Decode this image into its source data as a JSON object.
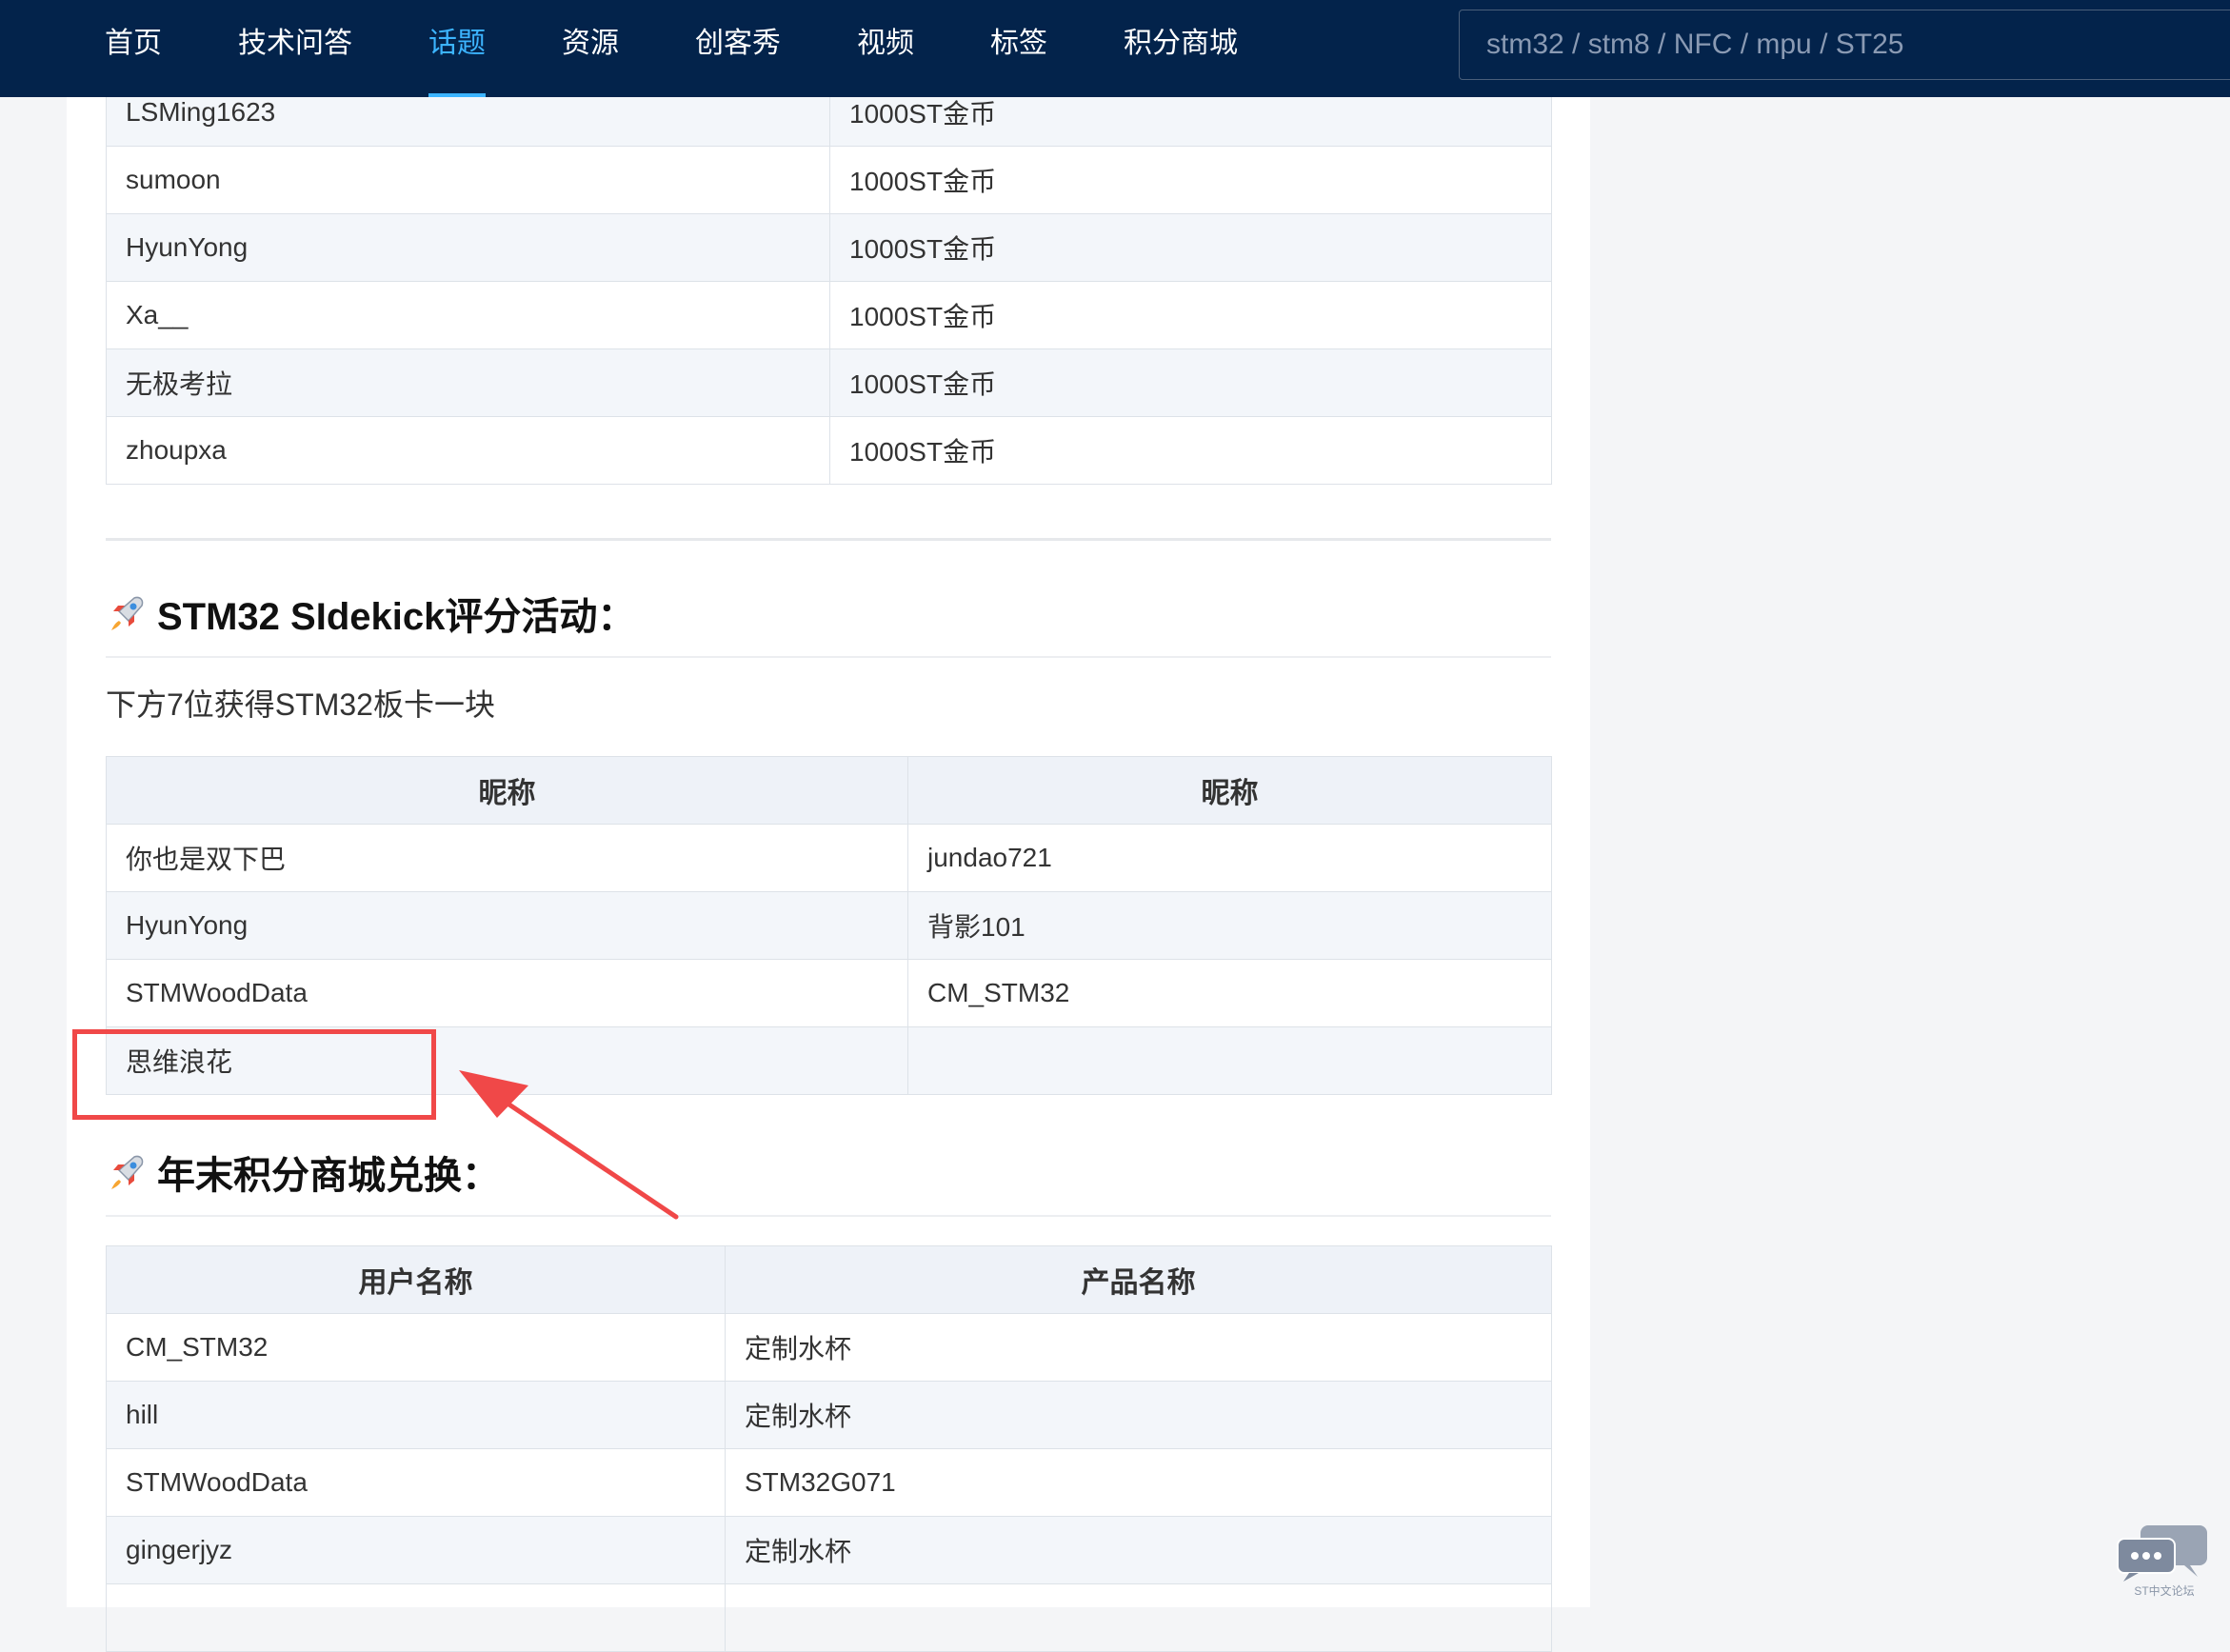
{
  "nav": {
    "items": [
      {
        "label": "首页"
      },
      {
        "label": "技术问答"
      },
      {
        "label": "话题",
        "active": true
      },
      {
        "label": "资源"
      },
      {
        "label": "创客秀"
      },
      {
        "label": "视频"
      },
      {
        "label": "标签"
      },
      {
        "label": "积分商城"
      }
    ],
    "search_placeholder": "stm32 / stm8 / NFC / mpu / ST25"
  },
  "colors": {
    "nav_bg": "#03234b",
    "nav_active": "#3cb4ff",
    "highlight": "#f04848"
  },
  "table1": {
    "rows": [
      [
        "LSMing1623",
        "1000ST金币"
      ],
      [
        "sumoon",
        "1000ST金币"
      ],
      [
        "HyunYong",
        "1000ST金币"
      ],
      [
        "Xa__",
        "1000ST金币"
      ],
      [
        "无极考拉",
        "1000ST金币"
      ],
      [
        "zhoupxa",
        "1000ST金币"
      ]
    ]
  },
  "sidekick": {
    "title": "STM32 SIdekick评分活动：",
    "intro": "下方7位获得STM32板卡一块",
    "headers": [
      "昵称",
      "昵称"
    ],
    "rows": [
      [
        "你也是双下巴",
        "jundao721"
      ],
      [
        "HyunYong",
        "背影101"
      ],
      [
        "STMWoodData",
        "CM_STM32"
      ],
      [
        "思维浪花",
        ""
      ]
    ]
  },
  "exchange": {
    "title": "年末积分商城兑换：",
    "headers": [
      "用户名称",
      "产品名称"
    ],
    "rows": [
      [
        "CM_STM32",
        "定制水杯"
      ],
      [
        "hill",
        "定制水杯"
      ],
      [
        "STMWoodData",
        "STM32G071"
      ],
      [
        "gingerjyz",
        "定制水杯"
      ],
      [
        "",
        ""
      ]
    ]
  },
  "chat_widget": {
    "icon": "chat-bubbles-icon",
    "caption": "ST中文论坛"
  }
}
